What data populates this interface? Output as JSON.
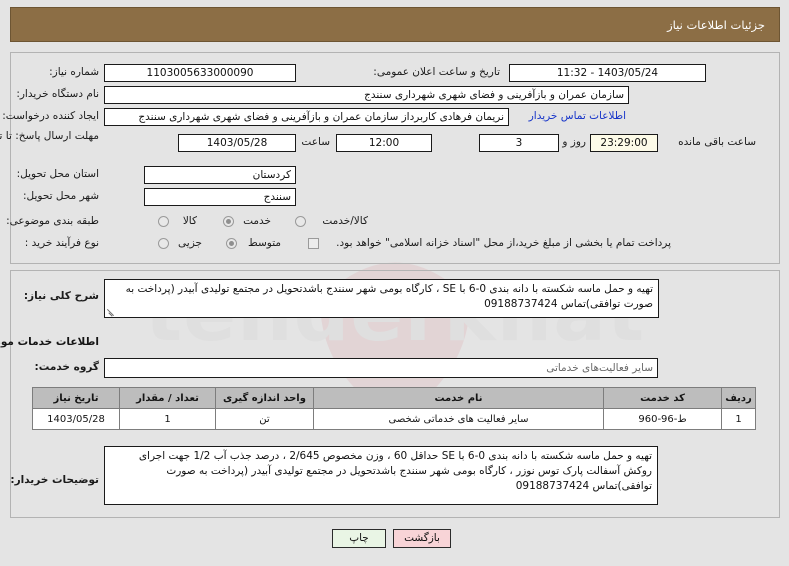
{
  "header": {
    "title": "جزئیات اطلاعات نیاز"
  },
  "form": {
    "need_number_label": "شماره نیاز:",
    "need_number_value": "1103005633000090",
    "announce_datetime_label": "تاریخ و ساعت اعلان عمومی:",
    "announce_datetime_value": "1403/05/24 - 11:32",
    "buyer_org_label": "نام دستگاه خریدار:",
    "buyer_org_value": "سازمان عمران و بازآفرینی و فضای شهری شهرداری سنندج",
    "requester_label": "ایجاد کننده درخواست:",
    "requester_value": "نریمان فرهادی کاربرداز سازمان عمران و بازآفرینی و فضای شهری شهرداری سنندج",
    "contact_link": "اطلاعات تماس خریدار",
    "deadline_label": "مهلت ارسال پاسخ: تا تاریخ:",
    "deadline_date": "1403/05/28",
    "hour_label": "ساعت",
    "deadline_time": "12:00",
    "days_value": "3",
    "days_label": "روز و",
    "remaining_time": "23:29:00",
    "remaining_label": "ساعت باقی مانده",
    "province_label": "استان محل تحویل:",
    "province_value": "کردستان",
    "city_label": "شهر محل تحویل:",
    "city_value": "سنندج",
    "category_label": "طبقه بندی موضوعی:",
    "category_options": [
      {
        "label": "کالا",
        "selected": false
      },
      {
        "label": "خدمت",
        "selected": true
      },
      {
        "label": "کالا/خدمت",
        "selected": false
      }
    ],
    "process_label": "نوع فرآیند خرید :",
    "process_options": [
      {
        "label": "جزیی",
        "selected": false
      },
      {
        "label": "متوسط",
        "selected": true
      }
    ],
    "treasury_checkbox_label": "پرداخت تمام یا بخشی از مبلغ خرید،از محل \"اسناد خزانه اسلامی\" خواهد بود.",
    "treasury_checked": false
  },
  "summary": {
    "label": "شرح کلی نیاز:",
    "text": "تهیه و حمل ماسه شکسته با دانه بندی  0-6 با  SE ، کارگاه بومی شهر سنندج باشدتحویل در مجتمع تولیدی آبیدر (پرداخت به صورت توافقی)تماس 09188737424"
  },
  "services_section": {
    "heading": "اطلاعات خدمات مورد نیاز",
    "group_label": "گروه خدمت:",
    "group_value": "سایر فعالیت‌های خدماتی"
  },
  "table": {
    "columns": [
      "ردیف",
      "کد خدمت",
      "نام خدمت",
      "واحد اندازه گیری",
      "تعداد / مقدار",
      "تاریخ نیاز"
    ],
    "rows": [
      {
        "row_no": "1",
        "service_code": "ط-96-960",
        "service_name": "سایر فعالیت های خدماتی شخصی",
        "unit": "تن",
        "quantity": "1",
        "need_date": "1403/05/28"
      }
    ]
  },
  "buyer_notes": {
    "label": "توضیحات خریدار:",
    "text": "تهیه و حمل ماسه شکسته با دانه بندی  0-6 با  SE  حداقل 60 ،  وزن مخصوص 2/645 ، درصد جذب آب 1/2 جهت اجرای روکش آسفالت  پارک توس نوزر ، کارگاه بومی شهر سنندج باشدتحویل در مجتمع تولیدی آبیدر (پرداخت به صورت توافقی)تماس 09188737424"
  },
  "footer": {
    "print_label": "چاپ",
    "back_label": "بازگشت"
  },
  "colors": {
    "header_bg": "#8c6e45",
    "page_bg": "#e4e4e4",
    "link": "#1634c9",
    "print_btn_bg": "#e9f5e5",
    "back_btn_bg": "#f8d4d7",
    "table_header_bg": "#bdbdbd"
  }
}
